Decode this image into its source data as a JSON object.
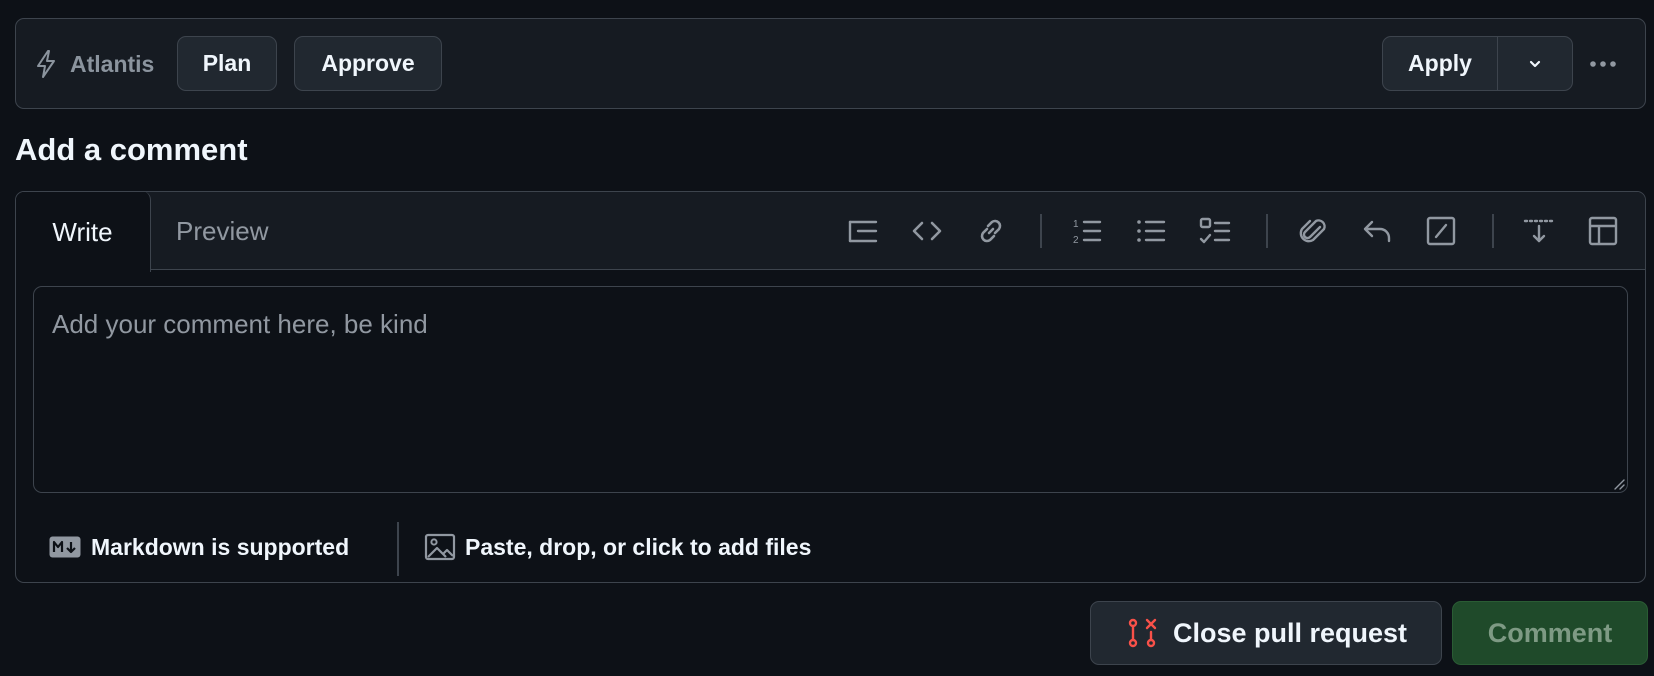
{
  "topbar": {
    "app_name": "Atlantis",
    "app_icon": "zap-icon",
    "plan_label": "Plan",
    "approve_label": "Approve",
    "apply_label": "Apply",
    "apply_menu_icon": "chevron-down-icon",
    "more_icon": "kebab-horizontal-icon"
  },
  "heading": "Add a comment",
  "editor": {
    "tabs": [
      {
        "label": "Write",
        "selected": true
      },
      {
        "label": "Preview",
        "selected": false
      }
    ],
    "toolbar": [
      "heading-icon",
      "code-icon",
      "link-icon",
      "ordered-list-icon",
      "unordered-list-icon",
      "task-list-icon",
      "attachment-icon",
      "reply-icon",
      "slash-command-icon",
      "collapse-icon",
      "table-icon"
    ],
    "placeholder": "Add your comment here, be kind",
    "value": "",
    "markdown_note": "Markdown is supported",
    "files_note": "Paste, drop, or click to add files"
  },
  "actions": {
    "close_label": "Close pull request",
    "comment_label": "Comment",
    "comment_enabled": false
  },
  "colors": {
    "background": "#0d1117",
    "surface": "#161b22",
    "border": "#3d444d",
    "text": "#f0f6fc",
    "muted": "#9198a1",
    "danger": "#f85149",
    "success_disabled": "#1f4a2a"
  }
}
